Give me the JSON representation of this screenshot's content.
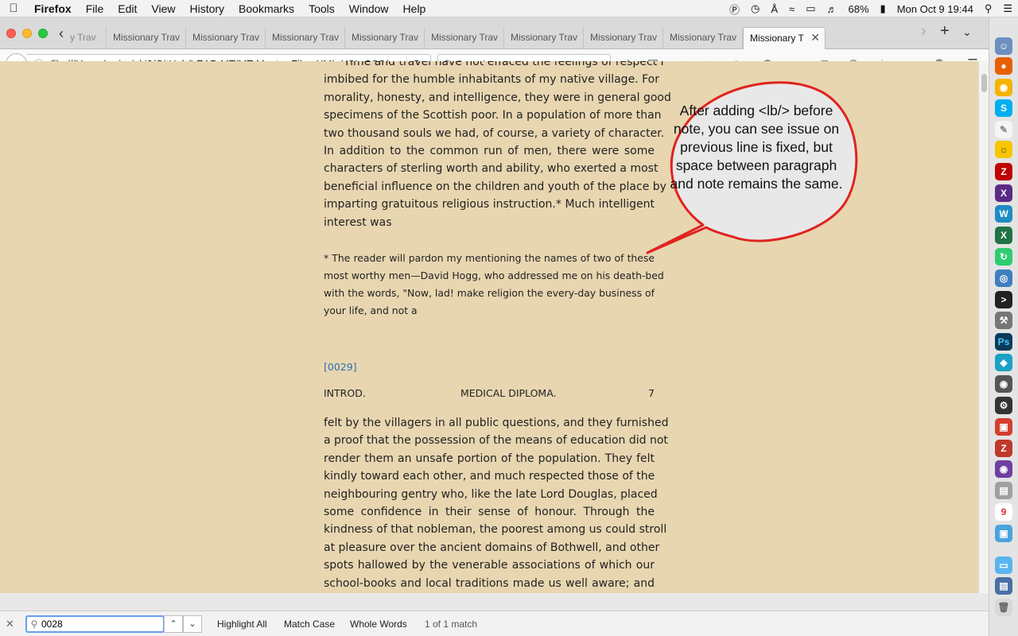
{
  "menubar": {
    "app_name": "Firefox",
    "items": [
      "File",
      "Edit",
      "View",
      "History",
      "Bookmarks",
      "Tools",
      "Window",
      "Help"
    ],
    "battery": "68%",
    "clock": "Mon Oct 9  19:44"
  },
  "tabs": {
    "first_partial": "y Trav",
    "items": [
      "Missionary Trav",
      "Missionary Trav",
      "Missionary Trav",
      "Missionary Trav",
      "Missionary Trav",
      "Missionary Trav",
      "Missionary Trav",
      "Missionary Trav",
      "Missionary Trav"
    ],
    "active": "Missionary T"
  },
  "navbar": {
    "url": "file:///Users/awisnicki2/GitHub/LEAP-MT/MT-Master-Files-XML-XSL-CSS/",
    "search_placeholder": "Search"
  },
  "document": {
    "paragraph1_lines": [
      "Time and travel have not effaced the feelings of respect I",
      "imbibed for the humble inhabitants of my native village. For",
      "morality, honesty, and intelligence, they were in general good",
      "specimens of the Scottish poor. In a population of more than",
      "two thousand souls we had, of course, a variety of character.",
      "In addition to the common run of men, there were some",
      "characters of sterling worth and ability, who exerted a most",
      "beneficial influence on the children and youth of the place by",
      "imparting gratuitous religious instruction.* Much intelligent",
      "interest was"
    ],
    "note_lines": [
      "* The reader will pardon my mentioning the names of two of these",
      "most worthy men—David Hogg, who addressed me on his death-bed",
      "with the words, \"Now, lad! make religion the every-day business of",
      "your life, and not a"
    ],
    "page_marker": "[0029]",
    "running_head": {
      "left": "INTROD.",
      "center": "MEDICAL DIPLOMA.",
      "right": "7"
    },
    "paragraph2_lines": [
      "felt by the villagers in all public questions, and they furnished",
      "a proof that the possession of the means of education did not",
      "render them an unsafe portion of the population. They felt",
      "kindly toward each other, and much respected those of the",
      "neighbouring gentry who, like the late Lord Douglas, placed",
      "some confidence in their sense of honour. Through the",
      "kindness of that nobleman, the poorest among us could stroll",
      "at pleasure over the ancient domains of Bothwell, and other",
      "spots hallowed by the venerable associations of which our",
      "school-books and local traditions made us well aware; and"
    ]
  },
  "callout": {
    "text": "After adding <lb/> before note, you can see issue on previous line is fixed, but space between paragraph and note remains the same."
  },
  "findbar": {
    "query": "0028",
    "highlight_all": "Highlight All",
    "match_case": "Match Case",
    "whole_words": "Whole Words",
    "status": "1 of 1 match"
  },
  "colors": {
    "page_background": "#e8d6b1",
    "callout_border": "#e0231f",
    "link": "#2f6fae"
  }
}
